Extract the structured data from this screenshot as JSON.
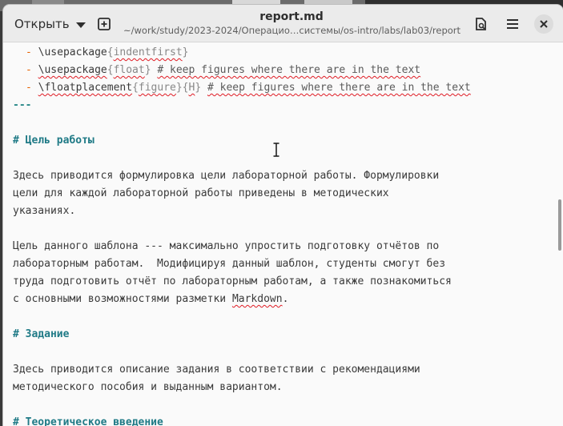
{
  "header": {
    "open_label": "Открыть",
    "title": "report.md",
    "subtitle": "~/work/study/2023-2024/Операцио…системы/os-intro/labs/lab03/report"
  },
  "editor": {
    "lines": [
      {
        "bullet": "- ",
        "cmd": "\\usepackage",
        "arg1": "indentfirst",
        "comment": ""
      },
      {
        "bullet": "- ",
        "cmd": "\\usepackage",
        "arg1": "float",
        "comment": "# keep figures where there are in the text"
      },
      {
        "bullet": "- ",
        "cmd": "\\floatplacement",
        "arg1": "figure",
        "arg2": "H",
        "comment": "# keep figures where there are in the text"
      }
    ],
    "rule": "---",
    "heading1": "# Цель работы",
    "p1": [
      "Здесь приводится формулировка цели лабораторной работы. Формулировки",
      "цели для каждой лабораторной работы приведены в методических",
      "указаниях."
    ],
    "p2": [
      "Цель данного шаблона --- максимально упростить подготовку отчётов по",
      "лабораторным работам.  Модифицируя данный шаблон, студенты смогут без",
      "труда подготовить отчёт по лабораторным работам, а также познакомиться",
      "с основными возможностями разметки "
    ],
    "markdown_word": "Markdown",
    "p2_end": ".",
    "heading2": "# Задание",
    "p3": [
      "Здесь приводится описание задания в соответствии с рекомендациями",
      "методического пособия и выданным вариантом."
    ],
    "heading3": "# Теоретическое введение"
  },
  "icons": {
    "new_tab": "new-tab-icon",
    "save": "save-icon",
    "menu": "hamburger-menu-icon",
    "close": "close-icon"
  }
}
